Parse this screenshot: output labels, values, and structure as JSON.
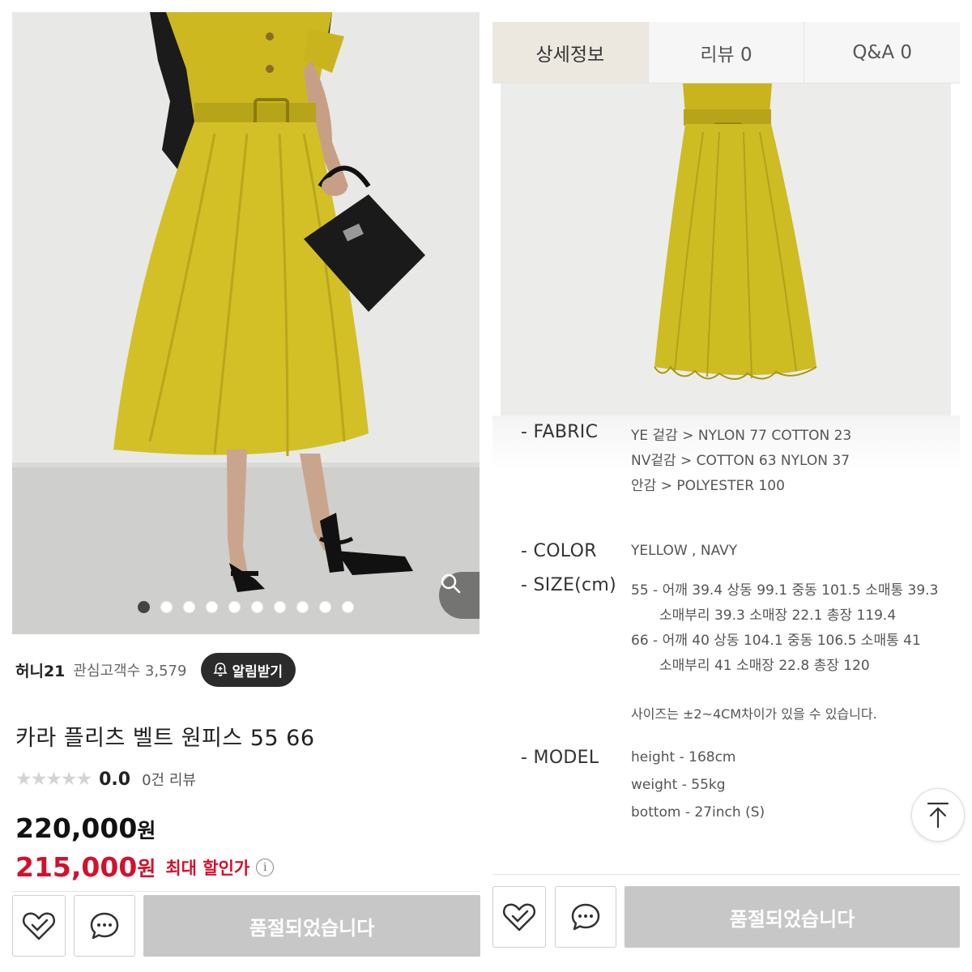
{
  "left": {
    "carousel": {
      "total": 10,
      "active_index": 0
    },
    "zoom_icon": "magnifier-icon",
    "seller": {
      "name": "허니21",
      "fans": "관심고객수 3,579",
      "alert_label": "알림받기",
      "alert_icon": "bell-plus-icon"
    },
    "product": {
      "title": "카라 플리츠 벨트 원피스 55 66",
      "stars": "★★★★★",
      "rating": "0.0",
      "reviews": "0건 리뷰",
      "price": "220,000",
      "price_unit": "원",
      "sale_price": "215,000",
      "sale_unit": "원",
      "sale_label": "최대 할인가",
      "info_icon": "i"
    },
    "bottom_bar": {
      "like_icon": "heart-check-icon",
      "chat_icon": "chat-bubble-icon",
      "soldout_label": "품절되었습니다"
    }
  },
  "right": {
    "tabs": [
      {
        "label": "상세정보",
        "active": true
      },
      {
        "label": "리뷰  0",
        "active": false
      },
      {
        "label": "Q&A  0",
        "active": false
      }
    ],
    "specs": {
      "fabric_label": "- FABRIC",
      "fabric": [
        "YE 겉감 > NYLON 77 COTTON 23",
        "NV겉감 >  COTTON 63 NYLON 37",
        "안감 > POLYESTER 100"
      ],
      "color_label": "- COLOR",
      "color": "YELLOW , NAVY",
      "size_label": "- SIZE(cm)",
      "size": [
        "55 - 어깨 39.4 상동 99.1  중동 101.5 소매통 39.3",
        "소매부리 39.3 소매장 22.1 총장 119.4",
        "66 - 어깨 40 상동 104.1 중동 106.5 소매통 41",
        "소매부리 41 소매장 22.8 총장 120"
      ],
      "size_note": "사이즈는 ±2~4CM차이가 있을 수 있습니다.",
      "model_label": "- MODEL",
      "model": [
        "height - 168cm",
        "weight - 55kg",
        "bottom - 27inch (S)"
      ]
    },
    "top_icon": "arrow-up-to-top-icon",
    "bottom_bar": {
      "like_icon": "heart-check-icon",
      "chat_icon": "chat-bubble-icon",
      "soldout_label": "품절되었습니다"
    }
  },
  "colors": {
    "dress_yellow": "#d3c026",
    "sale_red": "#d2112d",
    "soldout_gray": "#c7c7c7",
    "tab_active_bg": "#ece8e0"
  }
}
